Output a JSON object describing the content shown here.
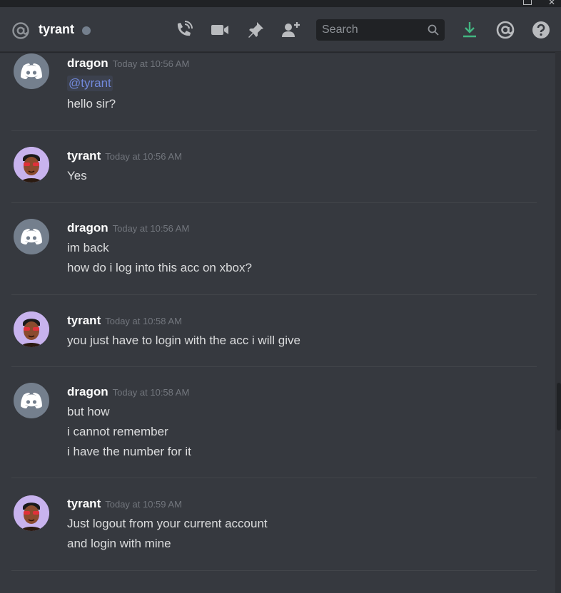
{
  "header": {
    "channel_name": "tyrant",
    "search_placeholder": "Search",
    "icons": [
      "at-icon",
      "phone-call-icon",
      "video-icon",
      "pin-icon",
      "add-friend-icon",
      "search-icon",
      "download-icon",
      "mentions-icon",
      "help-icon"
    ],
    "colors": {
      "download": "#43b581",
      "offline": "#747f8d"
    }
  },
  "messages": [
    {
      "author": "dragon",
      "timestamp": "Today at 10:56 AM",
      "mention": "@tyrant",
      "lines": [
        "hello sir?"
      ]
    },
    {
      "author": "tyrant",
      "timestamp": "Today at 10:56 AM",
      "lines": [
        "Yes"
      ]
    },
    {
      "author": "dragon",
      "timestamp": "Today at 10:56 AM",
      "lines": [
        "im back",
        "how do i log into this acc on xbox?"
      ]
    },
    {
      "author": "tyrant",
      "timestamp": "Today at 10:58 AM",
      "lines": [
        "you just have to login with the acc i will give"
      ]
    },
    {
      "author": "dragon",
      "timestamp": "Today at 10:58 AM",
      "lines": [
        "but how",
        "i cannot remember",
        "i have the number for it"
      ]
    },
    {
      "author": "tyrant",
      "timestamp": "Today at 10:59 AM",
      "lines": [
        "Just logout from your current account",
        "and login with mine"
      ]
    }
  ]
}
